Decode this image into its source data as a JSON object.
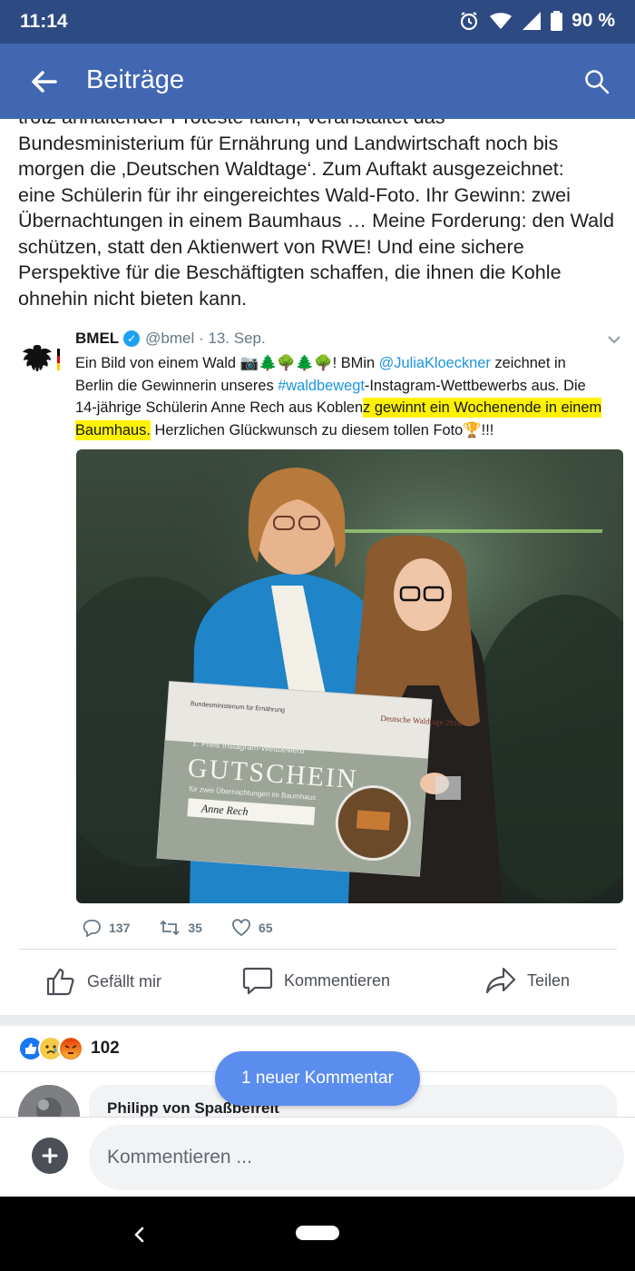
{
  "status_bar": {
    "time": "11:14",
    "battery": "90 %"
  },
  "app_bar": {
    "title": "Beiträge"
  },
  "post": {
    "lines": [
      "trotz anhaltender Proteste fällen, veranstaltet das",
      "Bundesministerium für Ernährung und Landwirtschaft noch bis",
      "morgen die ‚Deutschen Waldtage‘. Zum Auftakt ausgezeichnet:",
      "eine Schülerin für ihr eingereichtes Wald-Foto. Ihr Gewinn: zwei",
      "Übernachtungen in einem Baumhaus … Meine Forderung: den Wald",
      "schützen, statt den Aktienwert von RWE! Und eine sichere",
      "Perspektive für die Beschäftigten schaffen, die ihnen die Kohle",
      "ohnehin nicht bieten kann."
    ]
  },
  "tweet": {
    "name": "BMEL",
    "verified_mark": "✓",
    "handle_date": "@bmel · 13. Sep.",
    "line1_a": "Ein Bild von einem Wald 📷🌲🌳🌲🌳! BMin ",
    "line1_mention": "@JuliaKloeckner",
    "line1_b": " zeichnet in",
    "line2_a": "Berlin die Gewinnerin unseres ",
    "line2_hashtag": "#waldbewegt",
    "line2_b": "-Instagram-Wettbewerbs aus. Die",
    "line3_a": "14-jährige Schülerin Anne Rech aus Koblen",
    "line3_hl": "z gewinnt ein Wochenende in einem",
    "line4_hl": "Baumhaus.",
    "line4_b": " Herzlichen Glückwunsch zu diesem tollen Foto🏆!!!",
    "photo": {
      "voucher_title": "GUTSCHEIN",
      "voucher_sub": "für zwei Übernachtungen im Baumhaus",
      "voucher_name": "Anne Rech",
      "voucher_logo": "Deutsche Waldtage 2018",
      "voucher_prize": "1. Preis Instagram-Wettbewerb"
    },
    "replies": "137",
    "retweets": "35",
    "likes": "65"
  },
  "actions": {
    "like": "Gefällt mir",
    "comment": "Kommentieren",
    "share": "Teilen"
  },
  "reactions": {
    "count": "102"
  },
  "comment": {
    "author": "Philipp von Spaßbefreit"
  },
  "new_comment_label": "1 neuer Kommentar",
  "composer": {
    "placeholder": "Kommentieren ..."
  },
  "colors": {
    "status_bar": "#2e4a83",
    "app_bar": "#4267b2",
    "pill": "#5b8def",
    "highlight": "#fff200",
    "link": "#1b95e0"
  }
}
